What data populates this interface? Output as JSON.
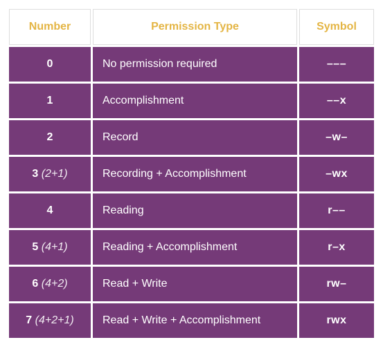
{
  "headers": {
    "number": "Number",
    "permission": "Permission Type",
    "symbol": "Symbol"
  },
  "rows": [
    {
      "num": "0",
      "detail": "",
      "perm": "No permission required",
      "sym": "–––"
    },
    {
      "num": "1",
      "detail": "",
      "perm": "Accomplishment",
      "sym": "––x"
    },
    {
      "num": "2",
      "detail": "",
      "perm": "Record",
      "sym": "–w–"
    },
    {
      "num": "3",
      "detail": " (2+1)",
      "perm": "Recording + Accomplishment",
      "sym": "–wx"
    },
    {
      "num": "4",
      "detail": "",
      "perm": "Reading",
      "sym": "r––"
    },
    {
      "num": "5",
      "detail": " (4+1)",
      "perm": "Reading + Accomplishment",
      "sym": "r–x"
    },
    {
      "num": "6",
      "detail": " (4+2)",
      "perm": "Read + Write",
      "sym": "rw–"
    },
    {
      "num": "7",
      "detail": " (4+2+1)",
      "perm": "Read + Write + Accomplishment",
      "sym": "rwx"
    }
  ],
  "chart_data": {
    "type": "table",
    "title": "Unix permission numbers, types, and symbols",
    "columns": [
      "Number",
      "Permission Type",
      "Symbol"
    ],
    "rows": [
      [
        "0",
        "No permission required",
        "---"
      ],
      [
        "1",
        "Accomplishment",
        "--x"
      ],
      [
        "2",
        "Record",
        "-w-"
      ],
      [
        "3 (2+1)",
        "Recording + Accomplishment",
        "-wx"
      ],
      [
        "4",
        "Reading",
        "r--"
      ],
      [
        "5 (4+1)",
        "Reading + Accomplishment",
        "r-x"
      ],
      [
        "6 (4+2)",
        "Read + Write",
        "rw-"
      ],
      [
        "7 (4+2+1)",
        "Read + Write + Accomplishment",
        "rwx"
      ]
    ]
  }
}
